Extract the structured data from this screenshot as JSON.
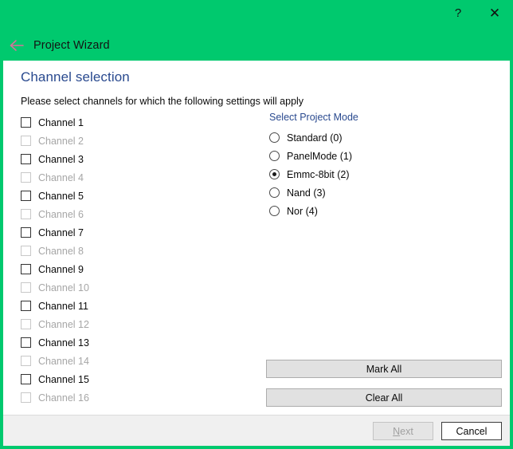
{
  "window": {
    "title": "Project Wizard",
    "accent_color": "#00c96e",
    "back_arrow_icon": "back-arrow-icon",
    "help_label": "?",
    "close_label": "✕"
  },
  "page": {
    "heading": "Channel selection",
    "heading_color": "#2a4a8f",
    "instruction": "Please select channels for which the following settings will apply"
  },
  "channels": [
    {
      "label": "Channel 1",
      "checked": false,
      "enabled": true
    },
    {
      "label": "Channel 2",
      "checked": false,
      "enabled": false
    },
    {
      "label": "Channel 3",
      "checked": false,
      "enabled": true
    },
    {
      "label": "Channel 4",
      "checked": false,
      "enabled": false
    },
    {
      "label": "Channel 5",
      "checked": false,
      "enabled": true
    },
    {
      "label": "Channel 6",
      "checked": false,
      "enabled": false
    },
    {
      "label": "Channel 7",
      "checked": false,
      "enabled": true
    },
    {
      "label": "Channel 8",
      "checked": false,
      "enabled": false
    },
    {
      "label": "Channel 9",
      "checked": false,
      "enabled": true
    },
    {
      "label": "Channel 10",
      "checked": false,
      "enabled": false
    },
    {
      "label": "Channel 11",
      "checked": false,
      "enabled": true
    },
    {
      "label": "Channel 12",
      "checked": false,
      "enabled": false
    },
    {
      "label": "Channel 13",
      "checked": false,
      "enabled": true
    },
    {
      "label": "Channel 14",
      "checked": false,
      "enabled": false
    },
    {
      "label": "Channel 15",
      "checked": false,
      "enabled": true
    },
    {
      "label": "Channel 16",
      "checked": false,
      "enabled": false
    }
  ],
  "project_mode": {
    "title": "Select Project Mode",
    "title_color": "#2a4a8f",
    "selected": "Emmc-8bit (2)",
    "options": [
      {
        "label": "Standard (0)",
        "selected": false
      },
      {
        "label": "PanelMode (1)",
        "selected": false
      },
      {
        "label": "Emmc-8bit (2)",
        "selected": true
      },
      {
        "label": "Nand (3)",
        "selected": false
      },
      {
        "label": "Nor (4)",
        "selected": false
      }
    ]
  },
  "bulk_actions": {
    "mark_all": "Mark All",
    "clear_all": "Clear All"
  },
  "footer": {
    "next_label": "Next",
    "next_mnemonic": "N",
    "next_enabled": false,
    "cancel_label": "Cancel",
    "cancel_enabled": true
  }
}
